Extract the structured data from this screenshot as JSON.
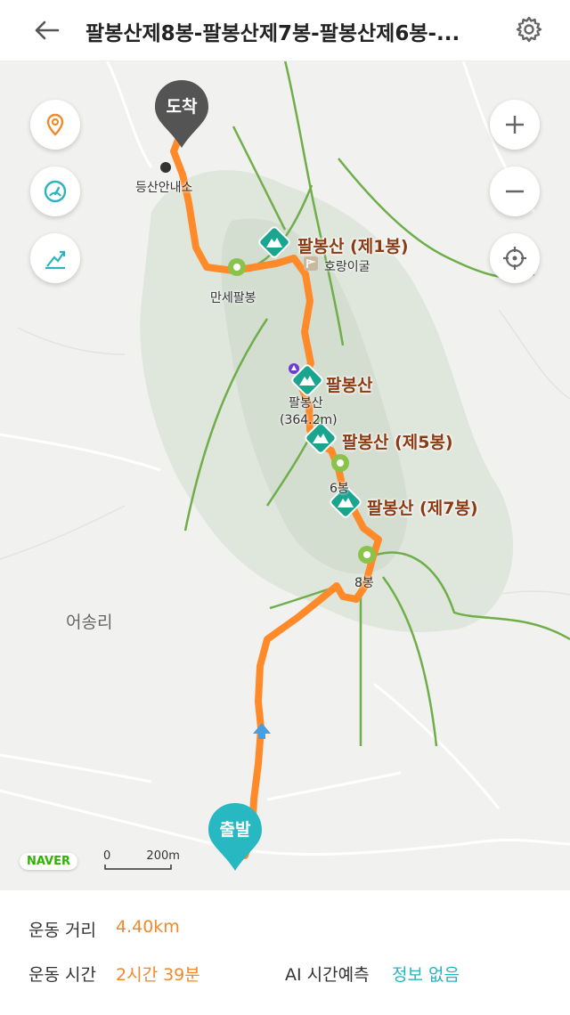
{
  "header": {
    "title": "팔봉산제8봉-팔봉산제7봉-팔봉산제6봉-...",
    "back_icon": "arrow-left-icon",
    "settings_icon": "gear-icon"
  },
  "map": {
    "left_controls": [
      "location-pin-icon",
      "speedometer-icon",
      "elevation-icon"
    ],
    "right_controls": [
      "zoom-in-icon",
      "zoom-out-icon",
      "locate-me-icon"
    ],
    "markers": {
      "arrival": "도착",
      "departure": "출발"
    },
    "labels": {
      "trail_office": "등산안내소",
      "peak1": "팔봉산 (제1봉)",
      "tiger_cave": "호랑이굴",
      "manse": "만세팔봉",
      "palbongsan": "팔봉산",
      "palbongsan_small": "팔봉산",
      "elevation": "(364.2m)",
      "peak5": "팔봉산 (제5봉)",
      "peak6": "6봉",
      "peak7": "팔봉산 (제7봉)",
      "peak8": "8봉",
      "village": "어송리"
    },
    "brand": "NAVER",
    "scale_zero": "0",
    "scale_label": "200m",
    "route_color": "#ff8a2a",
    "trail_color": "#6fae4a",
    "peak_marker_color": "#1aa58f"
  },
  "stats": {
    "distance_label": "운동 거리",
    "distance_value": "4.40km",
    "time_label": "운동 시간",
    "time_value": "2시간 39분",
    "ai_label": "AI 시간예측",
    "ai_value": "정보 없음",
    "accent_orange": "#f0892b",
    "accent_teal": "#2bb3c0"
  }
}
